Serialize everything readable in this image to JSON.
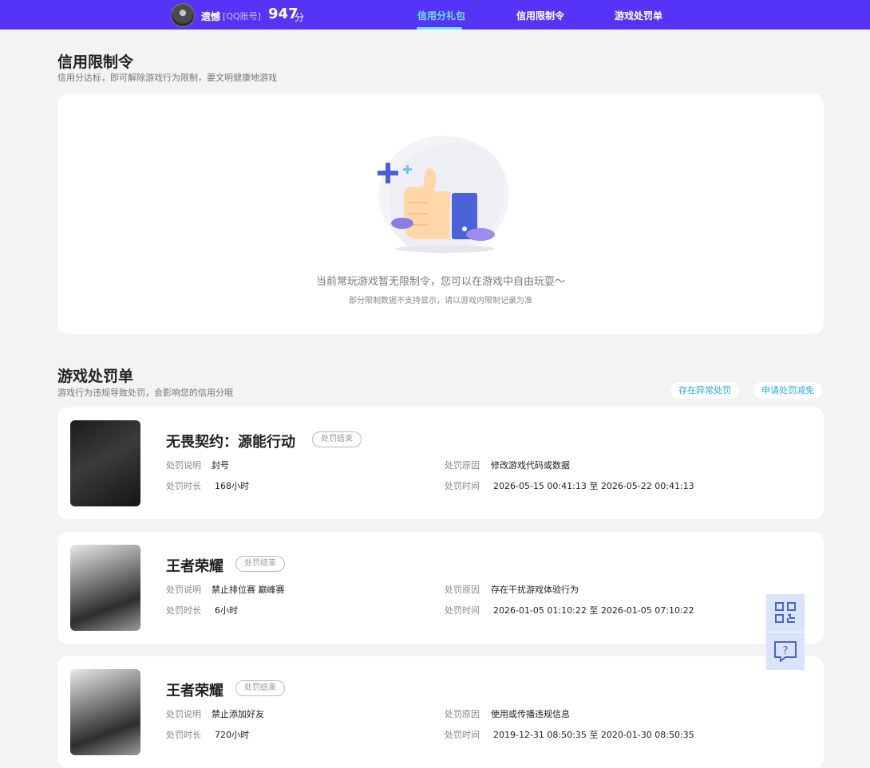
{
  "header": {
    "user_name": "遗憾",
    "account_type": "[QQ账号]",
    "score": "947",
    "score_unit": "分",
    "tabs": [
      {
        "label": "信用分礼包",
        "active": true
      },
      {
        "label": "信用限制令",
        "active": false
      },
      {
        "label": "游戏处罚单",
        "active": false
      }
    ]
  },
  "restriction": {
    "title": "信用限制令",
    "subtitle": "信用分达标，即可解除游戏行为限制，要文明健康地游戏",
    "empty_text": "当前常玩游戏暂无限制令，您可以在游戏中自由玩耍～",
    "empty_note": "部分限制数据不支持显示，请以游戏内限制记录为准"
  },
  "penalty": {
    "title": "游戏处罚单",
    "subtitle": "游戏行为违规导致处罚，会影响您的信用分哦",
    "buttons": {
      "abnormal": "存在异常处罚",
      "apply": "申请处罚减免"
    },
    "field_labels": {
      "desc": "处罚说明",
      "duration": "处罚时长",
      "reason": "处罚原因",
      "time": "处罚时间"
    },
    "items": [
      {
        "game": "无畏契约：源能行动",
        "status": "处罚结束",
        "desc": "封号",
        "duration": "168小时",
        "reason": "修改游戏代码或数据",
        "time": "2026-05-15 00:41:13 至 2026-05-22 00:41:13"
      },
      {
        "game": "王者荣耀",
        "status": "处罚结束",
        "desc": "禁止排位赛 巅峰赛",
        "duration": "6小时",
        "reason": "存在干扰游戏体验行为",
        "time": "2026-01-05 01:10:22 至 2026-01-05 07:10:22"
      },
      {
        "game": "王者荣耀",
        "status": "处罚结束",
        "desc": "禁止添加好友",
        "duration": "720小时",
        "reason": "使用或传播违规信息",
        "time": "2019-12-31 08:50:35 至 2020-01-30 08:50:35"
      }
    ]
  },
  "floating": {
    "qr_icon": "qr-code-icon",
    "feedback_icon": "feedback-question-icon"
  },
  "colors": {
    "topbar": "#5634f7",
    "active_tab": "#6fe0ff",
    "link": "#2aa9e8"
  }
}
